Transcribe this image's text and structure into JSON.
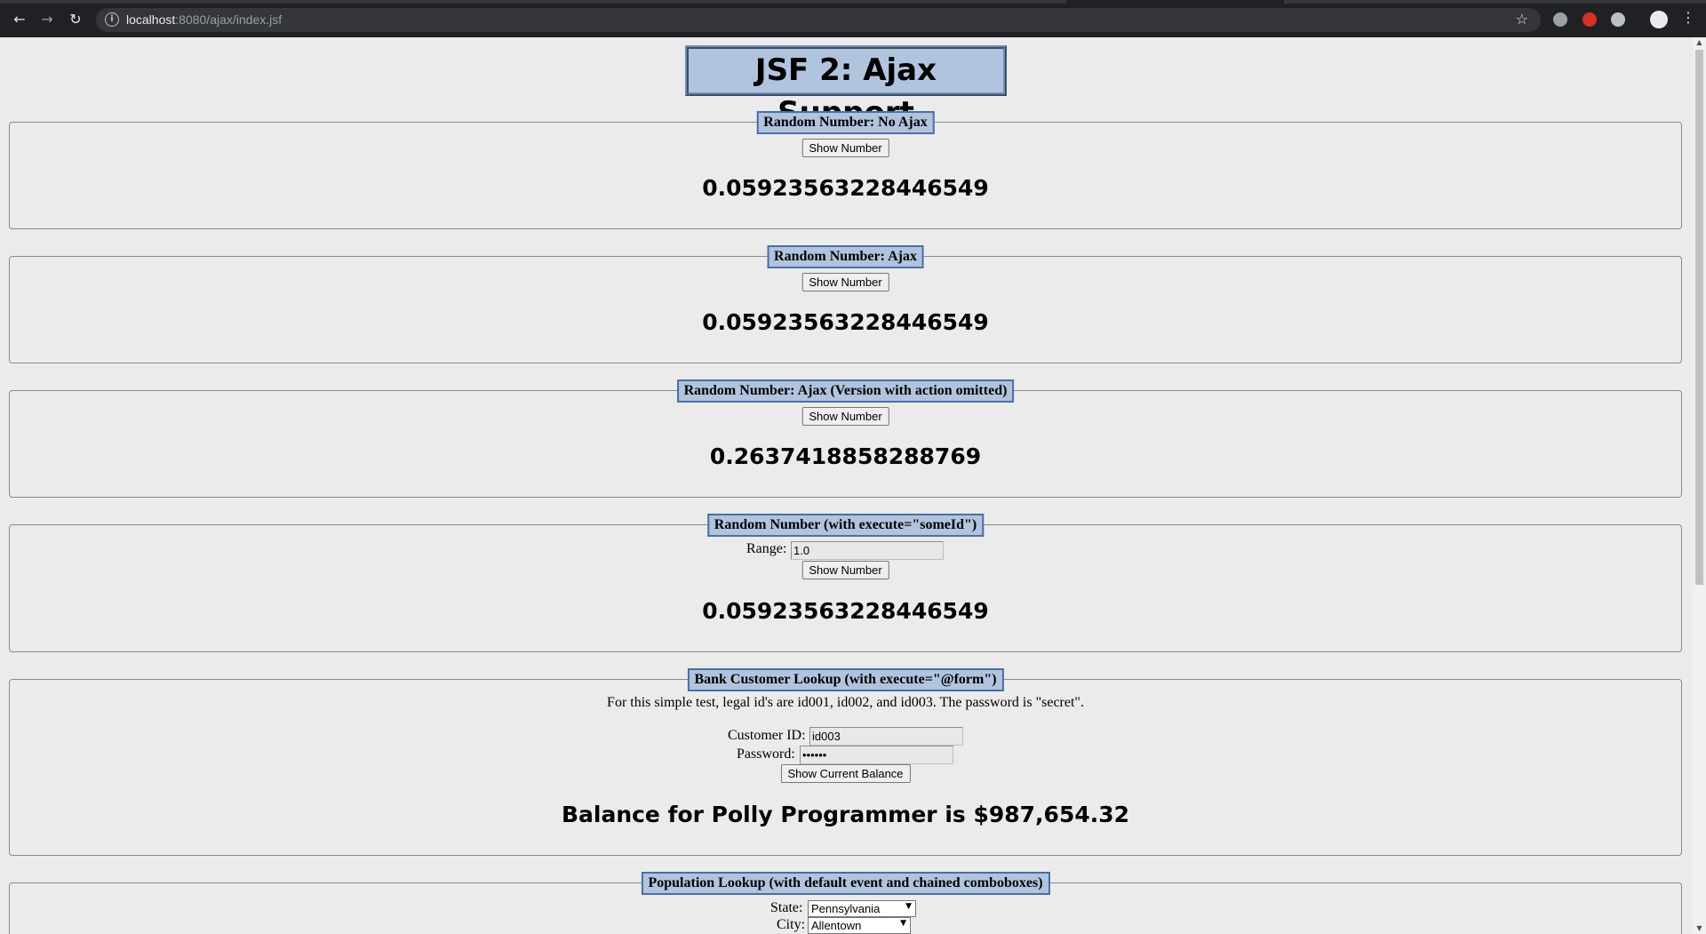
{
  "browser": {
    "url_host": "localhost",
    "url_rest": ":8080/ajax/index.jsf",
    "back_icon": "arrow-left-icon",
    "forward_icon": "arrow-right-icon",
    "reload_icon": "reload-icon",
    "info_icon": "info-icon",
    "star_icon": "star-icon",
    "menu_icon": "kebab-menu-icon"
  },
  "page": {
    "title": "JSF 2: Ajax Support"
  },
  "panels": {
    "no_ajax": {
      "legend": "Random Number: No Ajax",
      "button": "Show Number",
      "result": "0.05923563228446549"
    },
    "ajax": {
      "legend": "Random Number: Ajax",
      "button": "Show Number",
      "result": "0.05923563228446549"
    },
    "ajax_no_action": {
      "legend": "Random Number: Ajax (Version with action omitted)",
      "button": "Show Number",
      "result": "0.2637418858288769"
    },
    "execute_someid": {
      "legend": "Random Number (with execute=\"someId\")",
      "range_label": "Range:",
      "range_value": "1.0",
      "button": "Show Number",
      "result": "0.05923563228446549"
    },
    "bank": {
      "legend": "Bank Customer Lookup (with execute=\"@form\")",
      "note": "For this simple test, legal id's are id001, id002, and id003. The password is \"secret\".",
      "customer_id_label": "Customer ID:",
      "customer_id_value": "id003",
      "password_label": "Password:",
      "password_value": "••••••",
      "button": "Show Current Balance",
      "result": "Balance for Polly Programmer is $987,654.32"
    },
    "population": {
      "legend": "Population Lookup (with default event and chained comboboxes)",
      "state_label": "State:",
      "state_value": "Pennsylvania",
      "city_label": "City:",
      "city_value": "Allentown"
    }
  },
  "colors": {
    "legend_bg": "#b0c4de",
    "legend_border": "#4a6fa5",
    "page_bg": "#ebebeb",
    "chrome_bg": "#202124"
  }
}
